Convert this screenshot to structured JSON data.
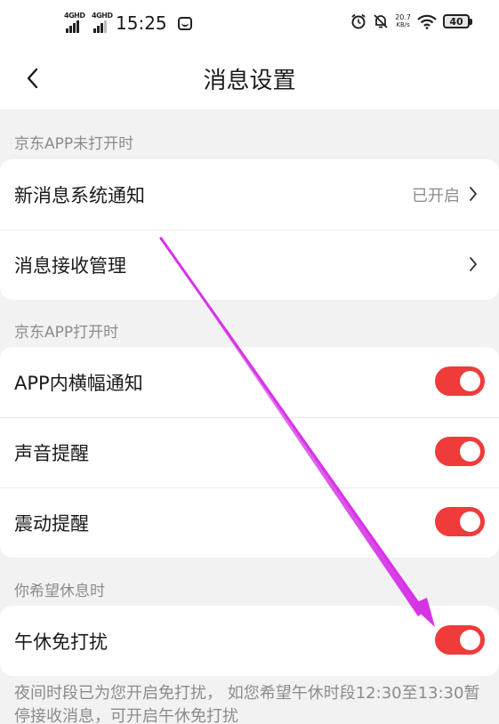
{
  "status_bar": {
    "signal1": "4GHD",
    "signal2": "4GHD",
    "time": "15:25",
    "net_speed_value": "20.7",
    "net_speed_unit": "KB/s",
    "battery": "40"
  },
  "header": {
    "title": "消息设置"
  },
  "sections": [
    {
      "label": "京东APP未打开时",
      "rows": [
        {
          "label": "新消息系统通知",
          "value": "已开启"
        },
        {
          "label": "消息接收管理"
        }
      ]
    },
    {
      "label": "京东APP打开时",
      "rows": [
        {
          "label": "APP内横幅通知",
          "on": true
        },
        {
          "label": "声音提醒",
          "on": true
        },
        {
          "label": "震动提醒",
          "on": true
        }
      ]
    },
    {
      "label": "你希望休息时",
      "rows": [
        {
          "label": "午休免打扰",
          "on": true
        }
      ]
    }
  ],
  "footer_note": "夜间时段已为您开启免打扰， 如您希望午休时段12:30至13:30暂停接收消息，可开启午休免打扰",
  "colors": {
    "toggle_on": "#ef3b3a",
    "annotation_arrow": "#d633e6",
    "background": "#f2f2f2"
  }
}
